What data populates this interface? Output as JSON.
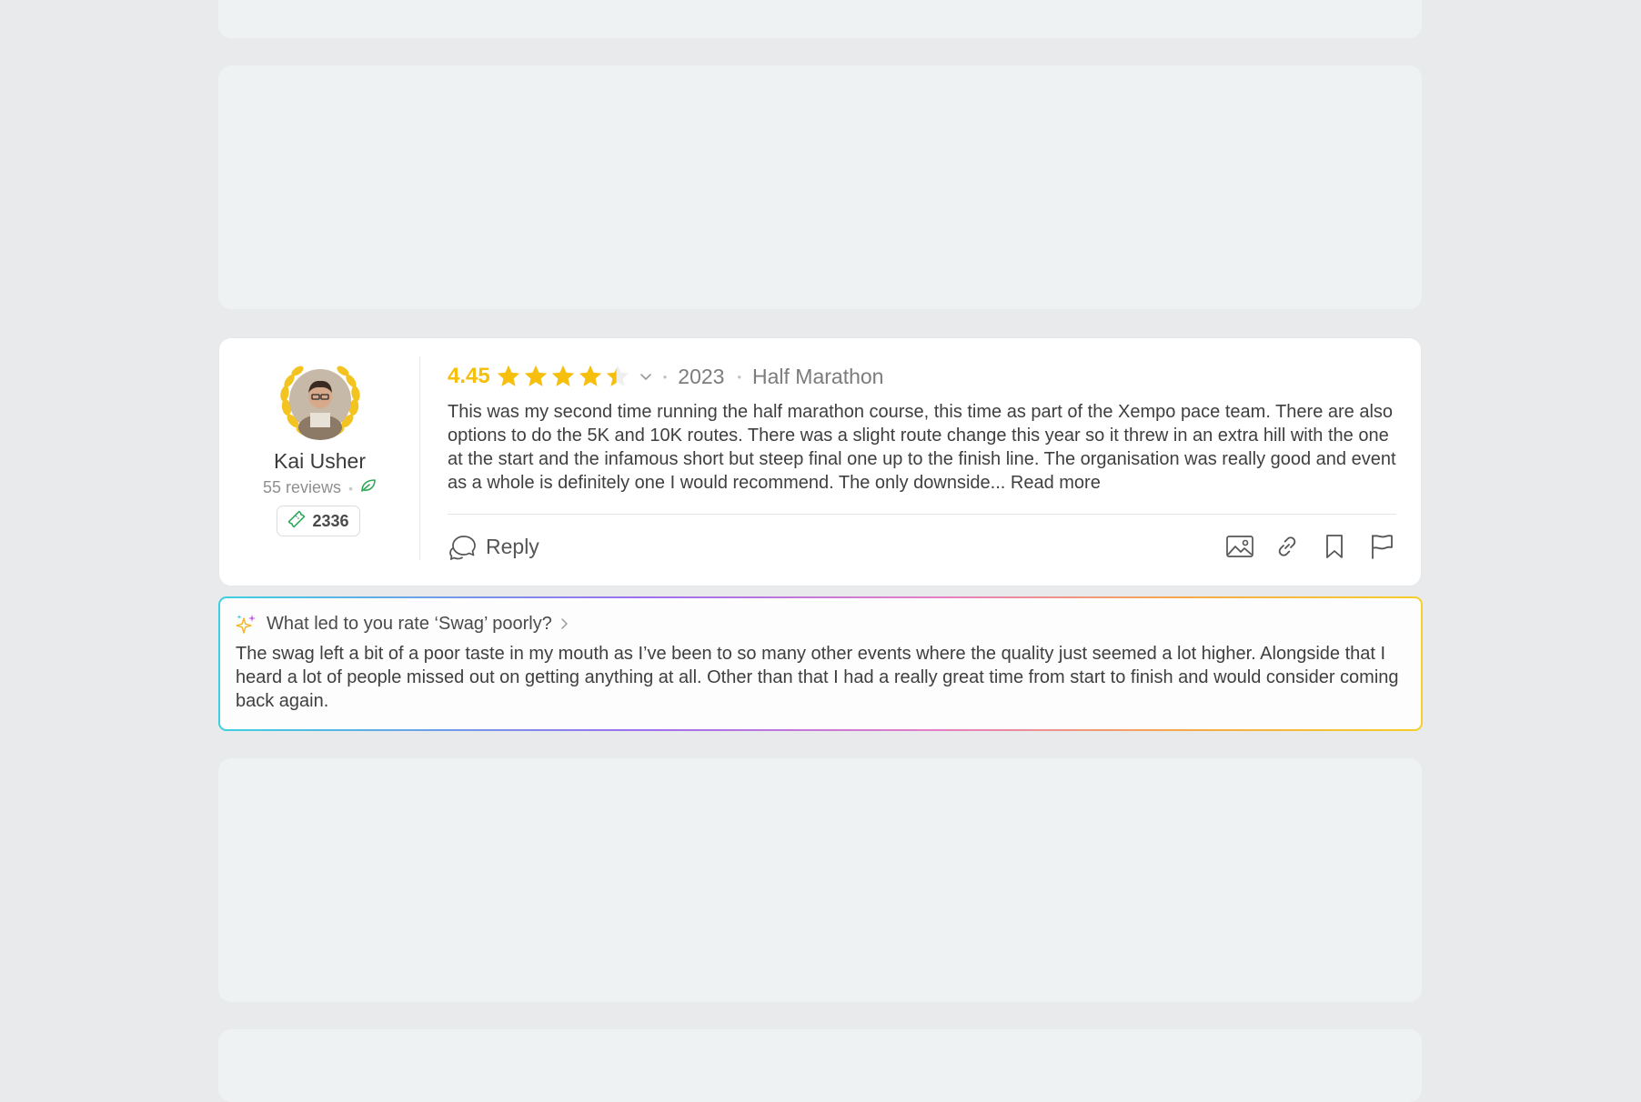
{
  "review": {
    "author": {
      "name": "Kai Usher",
      "reviews_count": "55 reviews",
      "points": "2336"
    },
    "rating_value": "4.45",
    "rating_stars": 4.45,
    "year": "2023",
    "event": "Half Marathon",
    "body": "This was my second time running the half marathon course, this time as part of the Xempo pace team. There are also options to do the 5K and 10K routes. There was a slight route change this year so it threw in an extra hill with the one at the start and the infamous short but steep final one up to the finish line. The organisation was really good and event as a whole is definitely one I would recommend. The only downside...",
    "read_more": "Read more",
    "reply_label": "Reply",
    "actions": [
      "image-icon",
      "link-icon",
      "bookmark-icon",
      "flag-icon"
    ]
  },
  "followup": {
    "question": "What led to you rate ‘Swag’ poorly?",
    "answer": "The swag left a bit of a poor taste in my mouth as I’ve been to so many other events where the quality just seemed a lot higher.  Alongside that I heard a lot of people missed out on getting anything at all.  Other than that I had a really great time from start to finish and would consider coming back again."
  },
  "colors": {
    "star": "#f5bf0c",
    "badge_green": "#2fa85a",
    "laurel": "#f3c41f",
    "page_bg": "#e8eaeb",
    "placeholder_bg": "#eff2f3"
  }
}
